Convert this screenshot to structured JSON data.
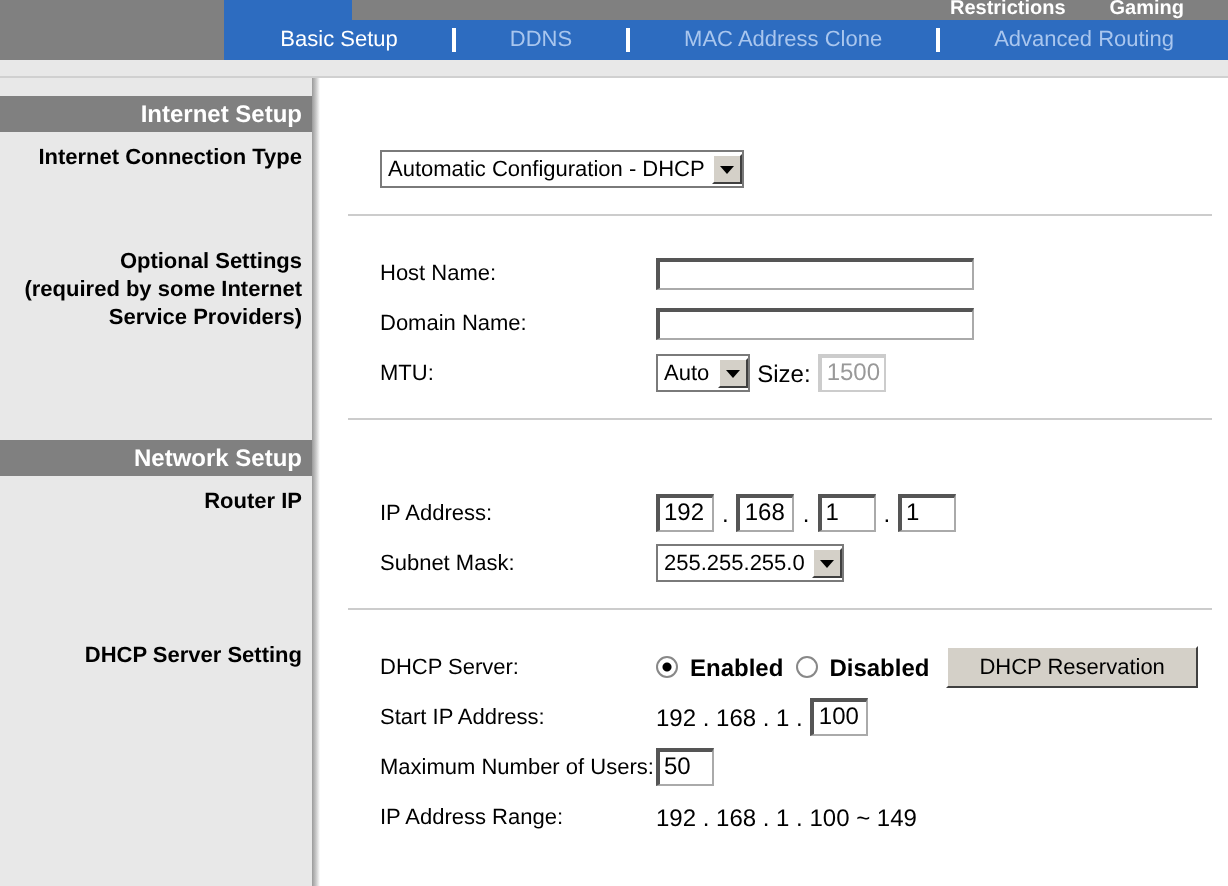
{
  "top_tabs": [
    {
      "label": "Restrictions"
    },
    {
      "label": "Gaming"
    }
  ],
  "sub_tabs": [
    {
      "label": "Basic Setup",
      "selected": true
    },
    {
      "label": "DDNS",
      "selected": false
    },
    {
      "label": "MAC Address Clone",
      "selected": false
    },
    {
      "label": "Advanced Routing",
      "selected": false
    }
  ],
  "sections": [
    {
      "title": "Internet Setup",
      "groups": [
        {
          "label": "Internet Connection Type",
          "rows": [
            {
              "controls": [
                {
                  "kind": "select",
                  "value": "Automatic Configuration - DHCP"
                }
              ]
            }
          ]
        },
        {
          "label": "Optional Settings\n(required by some Internet\nService Providers)",
          "rows": [
            {
              "label": "Host Name:",
              "controls": [
                {
                  "kind": "field"
                }
              ]
            },
            {
              "label": "Domain Name:",
              "controls": [
                {
                  "kind": "field"
                }
              ]
            },
            {
              "label": "MTU:",
              "controls": [
                {
                  "kind": "select",
                  "value": "Auto"
                },
                {
                  "kind": "text",
                  "value": "Size:"
                },
                {
                  "kind": "short-field",
                  "value": "1500",
                  "disabled": true
                }
              ]
            }
          ]
        }
      ]
    },
    {
      "title": "Network Setup",
      "groups": [
        {
          "label": "Router IP",
          "rows": [
            {
              "label": "IP Address:",
              "controls": [
                {
                  "kind": "short-field",
                  "value": "192",
                  "disabled": false
                },
                {
                  "kind": "text",
                  "value": "."
                },
                {
                  "kind": "short-field",
                  "value": "168",
                  "disabled": false
                },
                {
                  "kind": "text",
                  "value": "."
                },
                {
                  "kind": "short-field",
                  "value": "1",
                  "disabled": false
                },
                {
                  "kind": "text",
                  "value": "."
                },
                {
                  "kind": "short-field",
                  "value": "1",
                  "disabled": false
                }
              ]
            },
            {
              "label": "Subnet Mask:",
              "controls": [
                {
                  "kind": "select",
                  "value": "255.255.255.0"
                }
              ]
            }
          ]
        },
        {
          "label": "DHCP Server Setting",
          "rows": [
            {
              "label": "DHCP Server:",
              "controls": [
                {
                  "kind": "radio",
                  "value": "Enabled",
                  "selected": true
                },
                {
                  "kind": "radio",
                  "value": "Disabled",
                  "selected": false
                },
                {
                  "kind": "button",
                  "value": "DHCP Reservation"
                }
              ]
            },
            {
              "label": "Start IP Address:",
              "controls": [
                {
                  "kind": "text",
                  "value": "192 . 168 . 1 ."
                },
                {
                  "kind": "short-field",
                  "value": "100",
                  "disabled": false
                }
              ]
            },
            {
              "label": "Maximum Number of Users:",
              "controls": [
                {
                  "kind": "short-field",
                  "value": "50",
                  "disabled": false
                }
              ]
            },
            {
              "label": "IP Address Range:",
              "controls": [
                {
                  "kind": "text",
                  "value": "192 . 168 . 1 . 100 ~ 149"
                }
              ]
            }
          ]
        }
      ]
    }
  ]
}
